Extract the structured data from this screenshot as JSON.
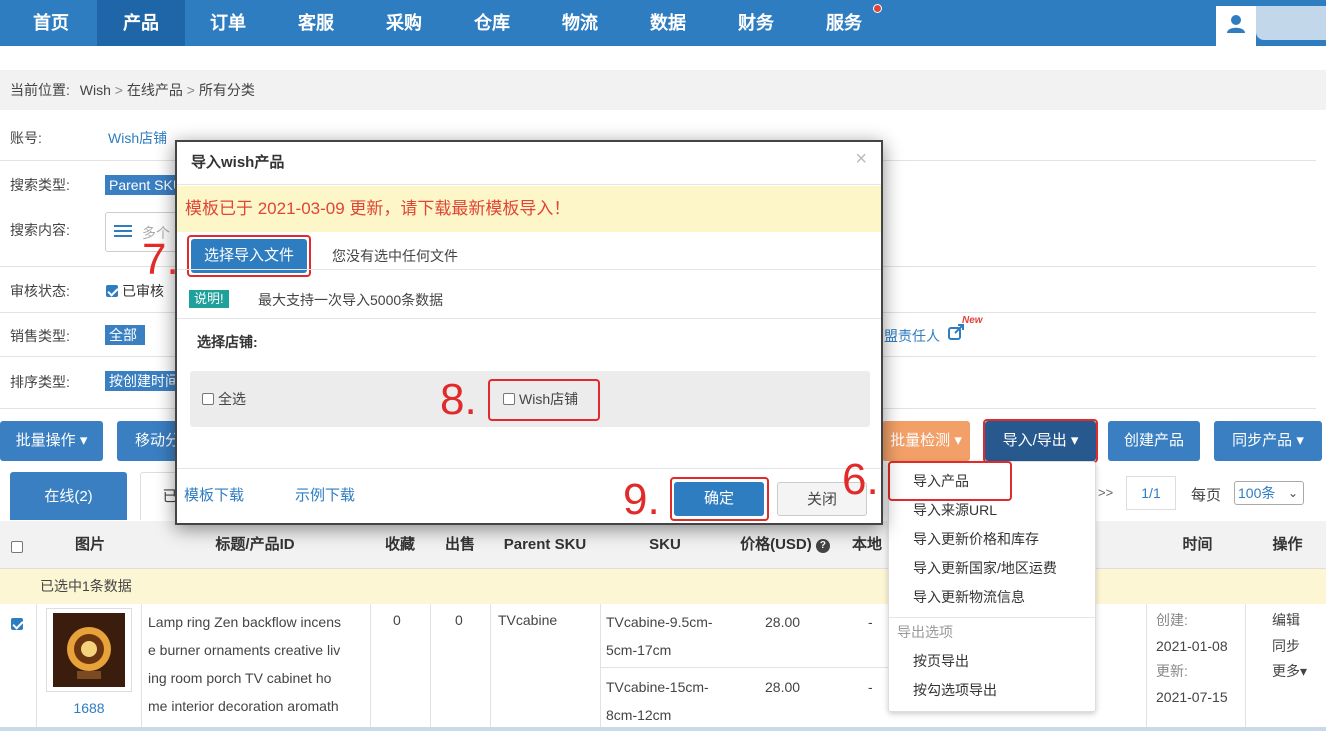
{
  "nav": {
    "items": [
      "首页",
      "产品",
      "订单",
      "客服",
      "采购",
      "仓库",
      "物流",
      "数据",
      "财务",
      "服务"
    ],
    "active_index": 1
  },
  "breadcrumb": {
    "prefix": "当前位置:",
    "path": [
      "Wish",
      "在线产品",
      "所有分类"
    ]
  },
  "filters": {
    "account_label": "账号:",
    "account_value": "Wish店铺",
    "search_type_label": "搜索类型:",
    "search_type_value": "Parent SKU",
    "search_content_label": "搜索内容:",
    "search_content_placeholder": "多个",
    "audit_label": "审核状态:",
    "audit_value": "已审核",
    "sales_label": "销售类型:",
    "sales_value": "全部",
    "sort_label": "排序类型:",
    "sort_value": "按创建时间",
    "responsible_link": "盟责任人",
    "new_badge": "New"
  },
  "toolbar": {
    "batch_ops": "批量操作",
    "move": "移动分",
    "batch_check": "批量检测",
    "import_export": "导入/导出",
    "create_product": "创建产品",
    "sync_product": "同步产品"
  },
  "tabs": {
    "online": "在线(2)",
    "other": "已"
  },
  "pagination": {
    "next": ">>",
    "page": "1/1",
    "per_page_label": "每页",
    "per_page_value": "100条"
  },
  "table": {
    "headers": {
      "image": "图片",
      "title": "标题/产品ID",
      "fav": "收藏",
      "sold": "出售",
      "parent_sku": "Parent SKU",
      "sku": "SKU",
      "price": "价格(USD)",
      "local": "本地",
      "time": "时间",
      "ops": "操作"
    },
    "selected_notice": "已选中1条数据",
    "row": {
      "image_caption": "1688",
      "title": "Lamp ring Zen backflow incense burner ornaments creative living room porch TV cabinet home interior decoration aromath",
      "title_lines": [
        "Lamp ring Zen backflow incens",
        "e burner ornaments creative liv",
        "ing room porch TV cabinet ho",
        "me interior decoration aromath"
      ],
      "fav": "0",
      "sold": "0",
      "parent_sku": "TVcabine",
      "skus": [
        {
          "sku_lines": [
            "TVcabine-9.5cm-",
            "5cm-17cm"
          ],
          "price": "28.00",
          "local": "-"
        },
        {
          "sku_lines": [
            "TVcabine-15cm-",
            "8cm-12cm"
          ],
          "price": "28.00",
          "local": "-"
        }
      ],
      "created_label": "创建:",
      "created_date": "2021-01-08",
      "updated_label": "更新:",
      "updated_date": "2021-07-15",
      "ops": [
        "编辑",
        "同步",
        "更多"
      ]
    }
  },
  "dropdown": {
    "items": [
      "导入产品",
      "导入来源URL",
      "导入更新价格和库存",
      "导入更新国家/地区运费",
      "导入更新物流信息"
    ],
    "export_header": "导出选项",
    "export_items": [
      "按页导出",
      "按勾选项导出"
    ]
  },
  "modal": {
    "title": "导入wish产品",
    "close": "×",
    "warning": "模板已于 2021-03-09 更新，请下载最新模板导入！",
    "choose_file": "选择导入文件",
    "no_file": "您没有选中任何文件",
    "note_badge": "说明!",
    "note_text": "最大支持一次导入5000条数据",
    "store_label": "选择店铺:",
    "select_all": "全选",
    "store_option": "Wish店铺",
    "template_download": "模板下载",
    "example_download": "示例下载",
    "confirm": "确定",
    "cancel": "关闭"
  },
  "steps": [
    "6.",
    "7.",
    "8.",
    "9."
  ],
  "colors": {
    "nav_bg": "#2f7dc1",
    "primary": "#3a7fc2",
    "accent_red": "#e12b2b",
    "warning_bg": "#fcf6c8"
  }
}
